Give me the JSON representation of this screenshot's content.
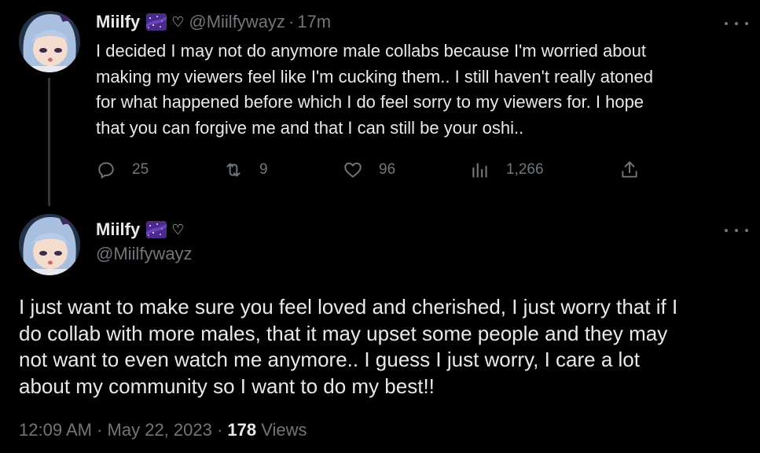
{
  "colors": {
    "background": "#000000",
    "text": "#e7e9ea",
    "muted": "#71767b",
    "line": "#333639"
  },
  "reply_tweet": {
    "display_name": "Miilfy",
    "badges": [
      "purple-galaxy-emoji",
      "heart-icon"
    ],
    "handle": "@Miilfywayz",
    "separator": "·",
    "time": "17m",
    "text_lines": [
      "I decided I may not do anymore male collabs because I'm worried about",
      "making my viewers feel like I'm cucking them.. I still haven't really atoned",
      "for what happened before which I do feel sorry to my viewers for. I hope",
      "that you can forgive me and that I can still be your oshi.."
    ],
    "actions": {
      "replies": "25",
      "retweets": "9",
      "likes": "96",
      "views": "1,266"
    }
  },
  "main_tweet": {
    "display_name": "Miilfy",
    "badges": [
      "purple-galaxy-emoji",
      "heart-icon"
    ],
    "handle": "@Miilfywayz",
    "text_lines": [
      "I just want to make sure you feel loved and cherished, I just worry that if I",
      "do collab with more males, that it may upset some people and they may",
      "not want to even watch me anymore.. I guess I just worry, I care a lot",
      "about my community so I want to do my best!!"
    ],
    "time": "12:09 AM",
    "separator": "·",
    "date": "May 22, 2023",
    "separator2": "·",
    "views_count": "178",
    "views_label": "Views"
  }
}
